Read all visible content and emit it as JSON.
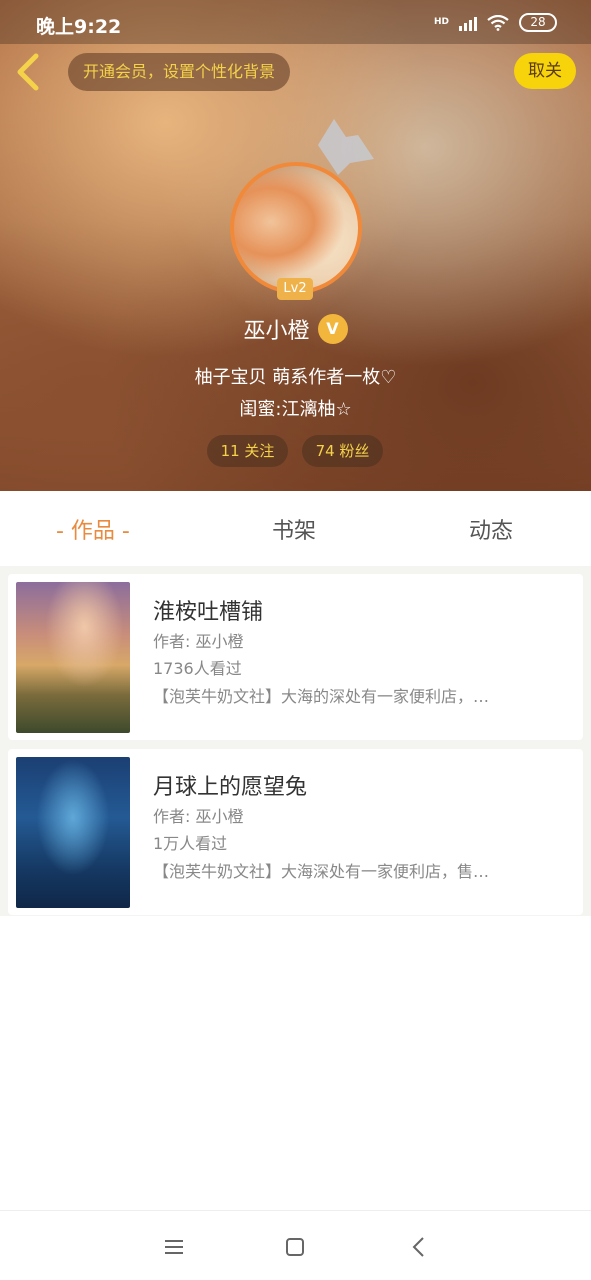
{
  "status_bar": {
    "time": "晚上9:22",
    "network": "HD",
    "battery": "28"
  },
  "header": {
    "vip_prompt": "开通会员，设置个性化背景",
    "cancel_label": "取关",
    "level_badge": "Lv2",
    "username": "巫小橙",
    "verified_badge": "V",
    "bio_line1": "柚子宝贝   萌系作者一枚♡",
    "bio_line2": "闺蜜:江漓柚☆",
    "following": "11 关注",
    "fans": "74 粉丝"
  },
  "tabs": [
    {
      "label": "- 作品 -",
      "active": true
    },
    {
      "label": "书架",
      "active": false
    },
    {
      "label": "动态",
      "active": false
    }
  ],
  "books": [
    {
      "title": "淮桉吐槽铺",
      "author": "作者: 巫小橙",
      "views": "1736人看过",
      "description": "【泡芙牛奶文社】大海的深处有一家便利店，…"
    },
    {
      "title": "月球上的愿望兔",
      "author": "作者: 巫小橙",
      "views": "1万人看过",
      "description": "【泡芙牛奶文社】大海深处有一家便利店，售…"
    }
  ],
  "icons": {
    "back": "chevron-left-icon",
    "crown": "crown-icon",
    "nav_menu": "menu-icon",
    "nav_home": "home-square-icon",
    "nav_back": "back-arrow-icon"
  },
  "colors": {
    "accent": "#e98a3f",
    "cancel_button": "#f6d30b",
    "pill_text": "#f4d24a"
  }
}
